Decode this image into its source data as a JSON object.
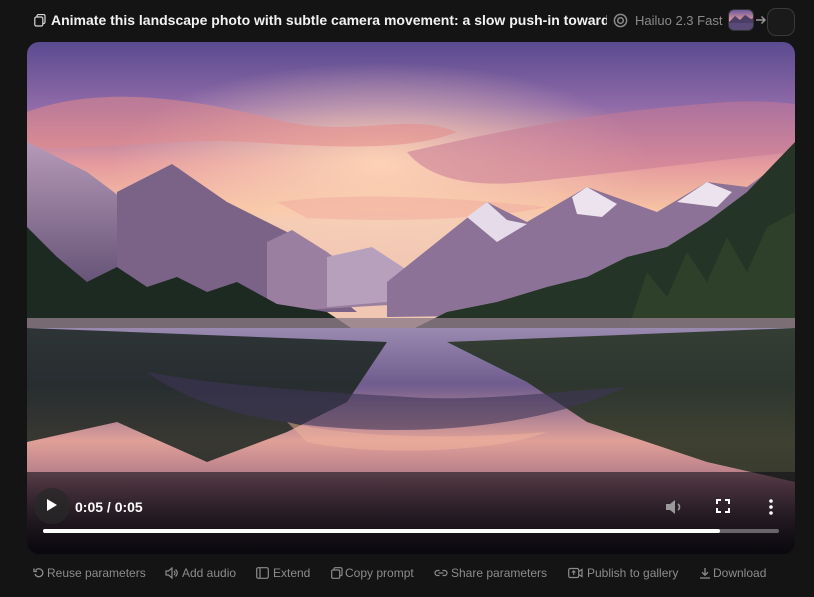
{
  "header": {
    "title": "Animate this landscape photo with subtle camera movement: a slow push-in toward...",
    "model": "Hailuo 2.3 Fast",
    "icons": {
      "copy": "copy-icon",
      "model": "model-logo-icon",
      "arrow": "arrow-right-icon"
    }
  },
  "player": {
    "time": "0:05 / 0:05",
    "progress": 0.92,
    "icons": {
      "play": "play-icon",
      "volume": "volume-icon",
      "fullscreen": "fullscreen-icon",
      "more": "more-vertical-icon"
    }
  },
  "actions": [
    {
      "label": "Reuse parameters",
      "icon": "reuse-icon"
    },
    {
      "label": "Add audio",
      "icon": "speaker-icon"
    },
    {
      "label": "Extend",
      "icon": "extend-icon"
    },
    {
      "label": "Copy prompt",
      "icon": "copy-icon"
    },
    {
      "label": "Share parameters",
      "icon": "link-icon"
    },
    {
      "label": "Publish to gallery",
      "icon": "publish-icon"
    },
    {
      "label": "Download",
      "icon": "download-icon"
    }
  ],
  "colors": {
    "background": "#141414",
    "text": "#f2f2f2",
    "muted": "#8c8c8c"
  }
}
